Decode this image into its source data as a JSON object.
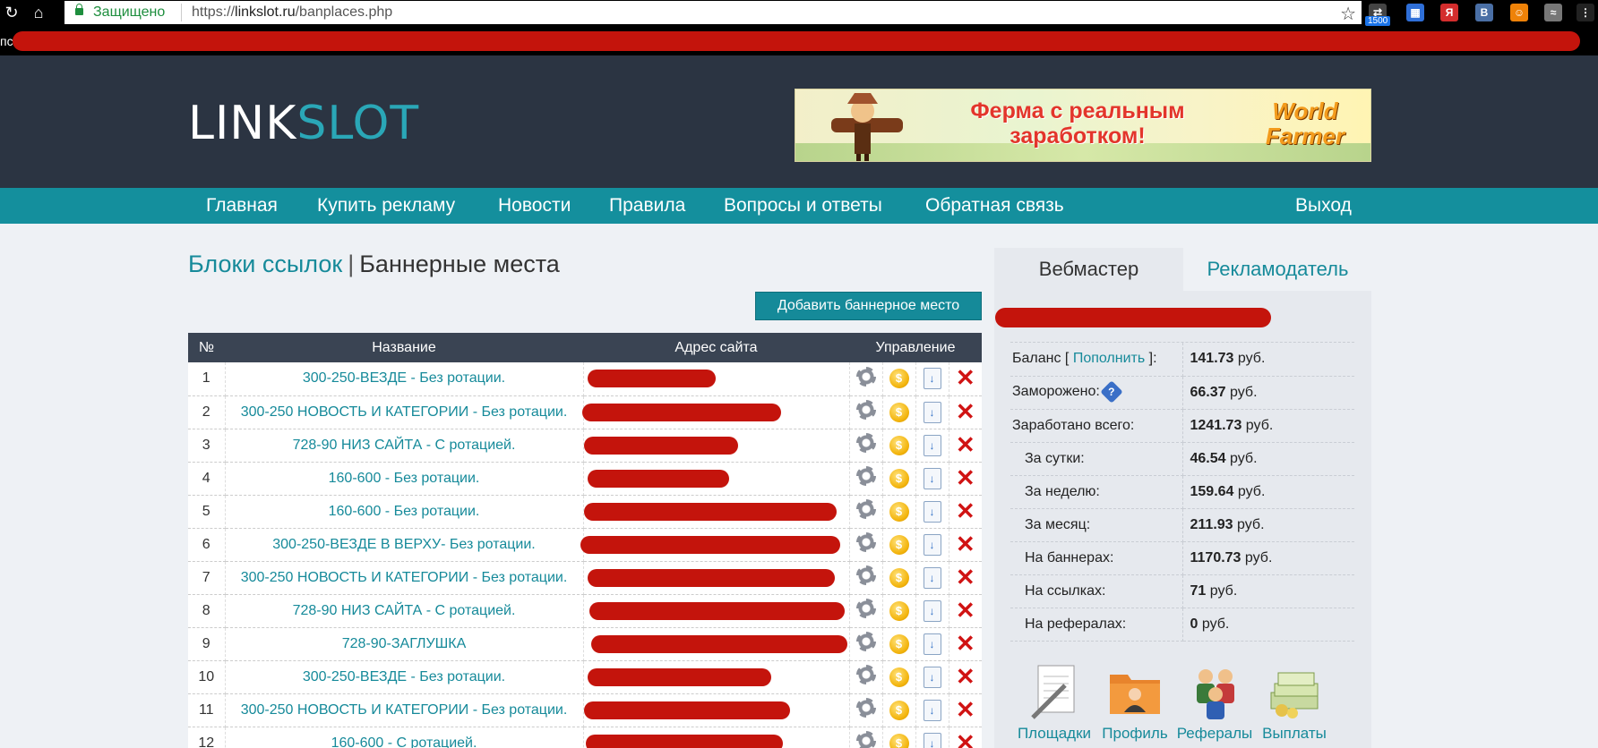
{
  "browser": {
    "secure_label": "Защищено",
    "url_scheme": "https://",
    "url_host": "linkslot.ru",
    "url_path": "/banplaces.php",
    "ext_badge": "1500",
    "bookmarks_prefix": "пс"
  },
  "site": {
    "logo_part1": "LINK",
    "logo_part2": "SLOT",
    "banner": {
      "text": "Ферма с реальным заработком!",
      "logo": "World Farmer"
    }
  },
  "nav": {
    "items": [
      "Главная",
      "Купить рекламу",
      "Новости",
      "Правила",
      "Вопросы и ответы",
      "Обратная связь"
    ],
    "logout": "Выход"
  },
  "page": {
    "crumb": "Блоки ссылок",
    "separator": "|",
    "title": "Баннерные места",
    "add_button": "Добавить баннерное место"
  },
  "table": {
    "headers": [
      "№",
      "Название",
      "Адрес сайта",
      "Управление"
    ],
    "rows": [
      {
        "num": "1",
        "name": "300-250-ВЕЗДЕ - Без ротации."
      },
      {
        "num": "2",
        "name": "300-250 НОВОСТЬ И КАТЕГОРИИ - Без ротации."
      },
      {
        "num": "3",
        "name": "728-90 НИЗ САЙТА - С ротацией."
      },
      {
        "num": "4",
        "name": "160-600 - Без ротации."
      },
      {
        "num": "5",
        "name": "160-600 - Без ротации."
      },
      {
        "num": "6",
        "name": "300-250-ВЕЗДЕ В ВЕРХУ- Без ротации."
      },
      {
        "num": "7",
        "name": "300-250 НОВОСТЬ И КАТЕГОРИИ - Без ротации."
      },
      {
        "num": "8",
        "name": "728-90 НИЗ САЙТА - С ротацией."
      },
      {
        "num": "9",
        "name": "728-90-ЗАГЛУШКА"
      },
      {
        "num": "10",
        "name": "300-250-ВЕЗДЕ - Без ротации."
      },
      {
        "num": "11",
        "name": "300-250 НОВОСТЬ И КАТЕГОРИИ - Без ротации."
      },
      {
        "num": "12",
        "name": "160-600 - С ротацией."
      }
    ]
  },
  "sidebar": {
    "tabs": [
      "Вебмастер",
      "Рекламодатель"
    ],
    "balance_label_pre": "Баланс [",
    "balance_link": "Пополнить",
    "balance_label_post": "]:",
    "stats": [
      {
        "label": "Заморожено:",
        "value": "66.37",
        "unit": "руб.",
        "help": "?"
      },
      {
        "label": "Заработано всего:",
        "value": "1241.73",
        "unit": "руб."
      },
      {
        "label": "За сутки:",
        "value": "46.54",
        "unit": "руб."
      },
      {
        "label": "За неделю:",
        "value": "159.64",
        "unit": "руб."
      },
      {
        "label": "За месяц:",
        "value": "211.93",
        "unit": "руб."
      },
      {
        "label": "На баннерах:",
        "value": "1170.73",
        "unit": "руб."
      },
      {
        "label": "На ссылках:",
        "value": "71",
        "unit": "руб."
      },
      {
        "label": "На рефералах:",
        "value": "0",
        "unit": "руб."
      }
    ],
    "balance_value": "141.73",
    "balance_unit": "руб.",
    "links": [
      "Площадки",
      "Профиль",
      "Рефералы",
      "Выплаты"
    ]
  },
  "colors": {
    "accent": "#148f9d",
    "header_bg": "#2b3442",
    "link": "#168a9a",
    "delete": "#d01313"
  }
}
